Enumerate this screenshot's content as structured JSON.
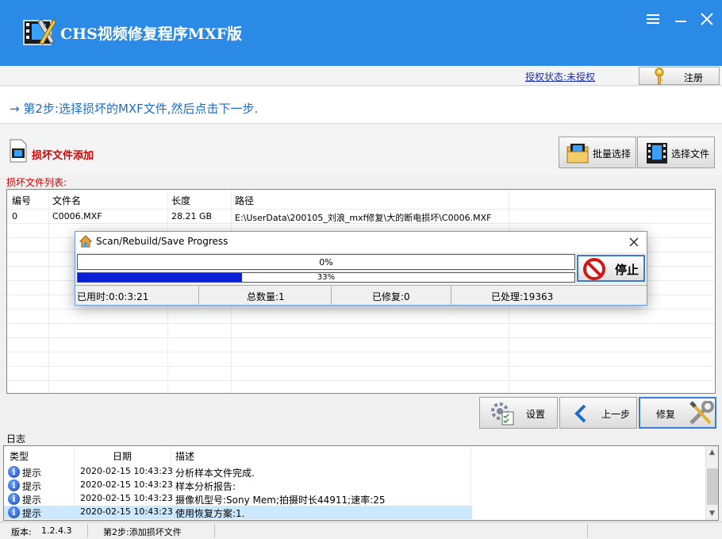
{
  "app": {
    "title": "CHS视频修复程序MXF版"
  },
  "license": {
    "status_link": "授权状态:未授权",
    "register_label": "注册"
  },
  "step": {
    "text": "第2步:选择损坏的MXF文件,然后点击下一步."
  },
  "section": {
    "title": "损坏文件添加",
    "batch_select_label": "批量选择",
    "select_file_label": "选择文件"
  },
  "file_list": {
    "caption": "损坏文件列表:",
    "columns": [
      "编号",
      "文件名",
      "长度",
      "路径"
    ],
    "rows": [
      {
        "index": "0",
        "name": "C0006.MXF",
        "size": "28.21 GB",
        "path": "E:\\UserData\\200105_刘浪_mxf修复\\大的断电损坏\\C0006.MXF"
      }
    ]
  },
  "progress_dialog": {
    "title": "Scan/Rebuild/Save Progress",
    "bar1_text": "0%",
    "bar1_value": 0,
    "bar2_text": "33%",
    "bar2_value": 0.33,
    "stop_label": "停止",
    "elapsed": "已用时:0:0:3:21",
    "total": "总数量:1",
    "repaired": "已修复:0",
    "processed": "已处理:19363"
  },
  "nav": {
    "settings_label": "设置",
    "prev_label": "上一步",
    "repair_label": "修复"
  },
  "log": {
    "caption": "日志",
    "columns": [
      "类型",
      "日期",
      "描述"
    ],
    "rows": [
      {
        "type": "提示",
        "date": "2020-02-15 10:43:23",
        "desc": "分析样本文件完成."
      },
      {
        "type": "提示",
        "date": "2020-02-15 10:43:23",
        "desc": "样本分析报告:"
      },
      {
        "type": "提示",
        "date": "2020-02-15 10:43:23",
        "desc": "摄像机型号:Sony Mem;拍摄时长44911;速率:25"
      },
      {
        "type": "提示",
        "date": "2020-02-15 10:43:23",
        "desc": "使用恢复方案:1."
      }
    ]
  },
  "status": {
    "version_label": "版本:",
    "version": "1.2.4.3",
    "step_status": "第2步:添加损坏文件"
  },
  "colors": {
    "titlebar": "#2a8ae6",
    "accent_text": "#1e6cc8",
    "alert_red": "#d40000",
    "progress_fill": "#0b1fd6"
  }
}
